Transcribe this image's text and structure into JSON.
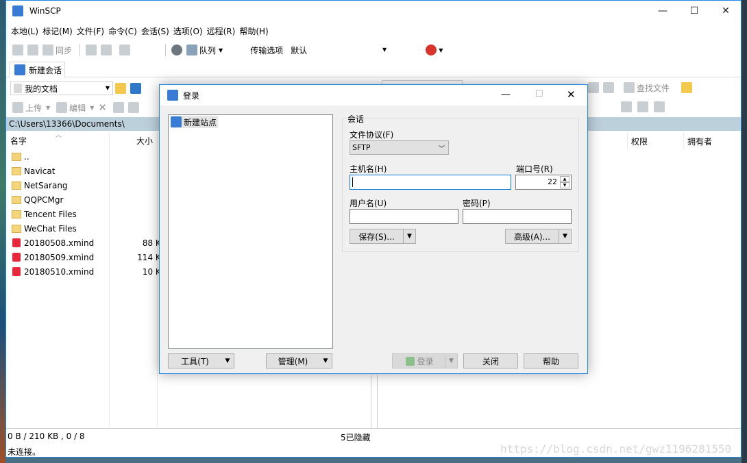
{
  "window": {
    "title": "WinSCP",
    "minimize": "—",
    "maximize": "☐",
    "close": "✕"
  },
  "menu": [
    "本地(L)",
    "标记(M)",
    "文件(F)",
    "命令(C)",
    "会话(S)",
    "选项(O)",
    "远程(R)",
    "帮助(H)"
  ],
  "toolbar": {
    "sync": "同步",
    "queue": "队列",
    "transfer_label": "传输选项",
    "transfer_value": "默认"
  },
  "tab": {
    "label": "新建会话"
  },
  "local": {
    "location": "我的文档",
    "upload": "上传",
    "edit": "编辑",
    "path": "C:\\Users\\13366\\Documents\\",
    "col_name": "名字",
    "col_size": "大小",
    "files": [
      {
        "name": "..",
        "size": "",
        "type": "up"
      },
      {
        "name": "Navicat",
        "size": "",
        "type": "folder"
      },
      {
        "name": "NetSarang",
        "size": "",
        "type": "folder"
      },
      {
        "name": "QQPCMgr",
        "size": "",
        "type": "folder"
      },
      {
        "name": "Tencent Files",
        "size": "",
        "type": "folder"
      },
      {
        "name": "WeChat Files",
        "size": "",
        "type": "folder"
      },
      {
        "name": "20180508.xmind",
        "size": "88 KB",
        "type": "xmind"
      },
      {
        "name": "20180509.xmind",
        "size": "114 KB",
        "type": "xmind"
      },
      {
        "name": "20180510.xmind",
        "size": "10 KB",
        "type": "xmind"
      }
    ]
  },
  "remote": {
    "find_files": "查找文件",
    "col_perm": "权限",
    "col_owner": "拥有者"
  },
  "status": {
    "selection": "0 B / 210 KB , 0 / 8",
    "hidden": "5已隐藏",
    "connection": "未连接。"
  },
  "dialog": {
    "title": "登录",
    "tree_item": "新建站点",
    "group": "会话",
    "protocol_label": "文件协议(F)",
    "protocol_value": "SFTP",
    "host_label": "主机名(H)",
    "port_label": "端口号(R)",
    "port_value": "22",
    "user_label": "用户名(U)",
    "password_label": "密码(P)",
    "save": "保存(S)...",
    "advanced": "高级(A)...",
    "tools": "工具(T)",
    "manage": "管理(M)",
    "login": "登录",
    "close": "关闭",
    "help": "帮助"
  },
  "watermark": "https://blog.csdn.net/gwz1196281550"
}
